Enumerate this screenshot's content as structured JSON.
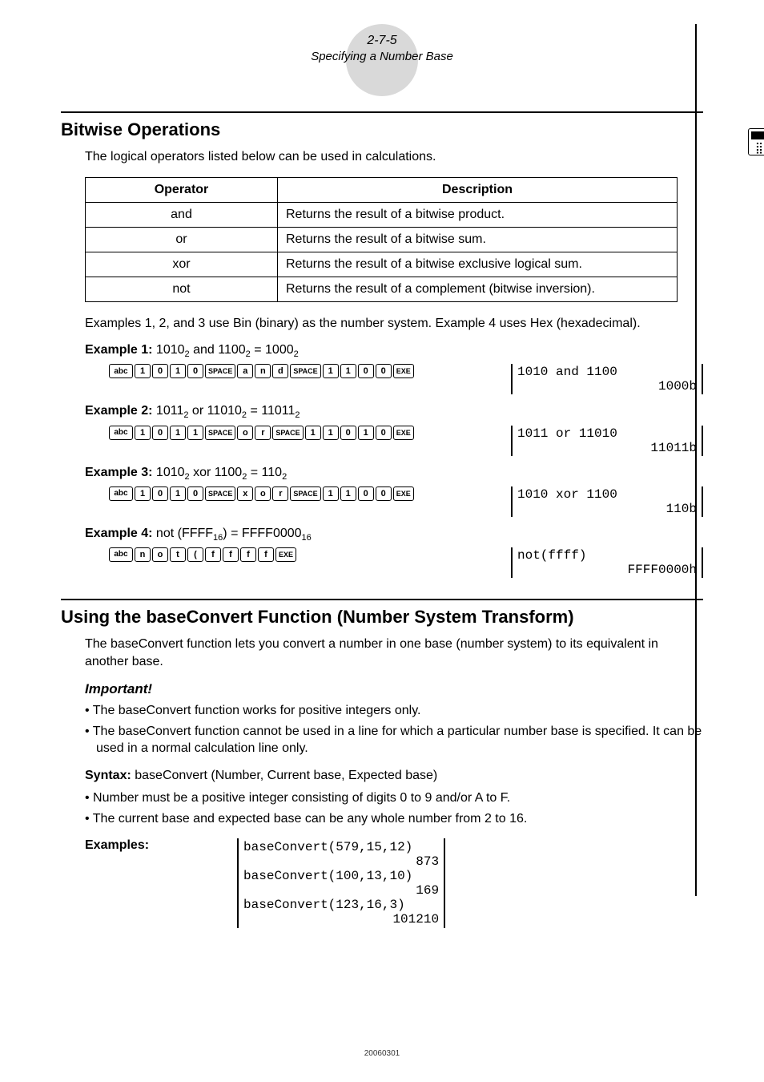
{
  "header": {
    "page_num": "2-7-5",
    "title": "Specifying a Number Base"
  },
  "section1": {
    "title": "Bitwise Operations",
    "intro": "The logical operators listed below can be used in calculations.",
    "table": {
      "headers": [
        "Operator",
        "Description"
      ],
      "rows": [
        {
          "op": "and",
          "desc": "Returns the result of a bitwise product."
        },
        {
          "op": "or",
          "desc": "Returns the result of a bitwise sum."
        },
        {
          "op": "xor",
          "desc": "Returns the result of a bitwise exclusive logical sum."
        },
        {
          "op": "not",
          "desc": "Returns the result of a complement (bitwise inversion)."
        }
      ]
    },
    "examples_intro": "Examples 1, 2, and 3 use Bin (binary) as the number system. Example 4 uses Hex (hexadecimal).",
    "examples": [
      {
        "label": "Example 1:",
        "expr_plain": "1010₂ and 1100₂ = 1000₂",
        "keys": [
          "abc",
          "1",
          "0",
          "1",
          "0",
          "SPACE",
          "a",
          "n",
          "d",
          "SPACE",
          "1",
          "1",
          "0",
          "0",
          "EXE"
        ],
        "screen_in": "1010 and 1100",
        "screen_out": "1000b"
      },
      {
        "label": "Example 2:",
        "expr_plain": "1011₂ or 11010₂ = 11011₂",
        "keys": [
          "abc",
          "1",
          "0",
          "1",
          "1",
          "SPACE",
          "o",
          "r",
          "SPACE",
          "1",
          "1",
          "0",
          "1",
          "0",
          "EXE"
        ],
        "screen_in": "1011 or 11010",
        "screen_out": "11011b"
      },
      {
        "label": "Example 3:",
        "expr_plain": "1010₂ xor 1100₂ = 110₂",
        "keys": [
          "abc",
          "1",
          "0",
          "1",
          "0",
          "SPACE",
          "x",
          "o",
          "r",
          "SPACE",
          "1",
          "1",
          "0",
          "0",
          "EXE"
        ],
        "screen_in": "1010 xor 1100",
        "screen_out": "110b"
      },
      {
        "label": "Example 4:",
        "expr_plain": "not (FFFF₁₆) = FFFF0000₁₆",
        "keys": [
          "abc",
          "n",
          "o",
          "t",
          "(",
          "f",
          "f",
          "f",
          "f",
          "EXE"
        ],
        "screen_in": "not(ffff)",
        "screen_out": "FFFF0000h"
      }
    ]
  },
  "section2": {
    "title": "Using the baseConvert Function (Number System Transform)",
    "intro": "The baseConvert function lets you convert a number in one base (number system) to its equivalent in another base.",
    "important_label": "Important!",
    "important_items": [
      "The baseConvert function works for positive integers only.",
      "The baseConvert function cannot be used in a line for which a particular number base is specified. It can be used in a normal calculation line only."
    ],
    "syntax_label": "Syntax:",
    "syntax_text": "baseConvert (Number, Current base, Expected base)",
    "syntax_items": [
      "Number must be a positive integer consisting of digits 0 to 9 and/or A to F.",
      "The current base and expected base can be any whole number from 2 to 16."
    ],
    "examples_label": "Examples:",
    "screen_lines": [
      {
        "in": "baseConvert(579,15,12)",
        "out": "873"
      },
      {
        "in": "baseConvert(100,13,10)",
        "out": "169"
      },
      {
        "in": "baseConvert(123,16,3)",
        "out": "101210"
      }
    ]
  },
  "chart_data": {
    "type": "table",
    "title": "Bitwise Operators",
    "columns": [
      "Operator",
      "Description"
    ],
    "rows": [
      [
        "and",
        "Returns the result of a bitwise product."
      ],
      [
        "or",
        "Returns the result of a bitwise sum."
      ],
      [
        "xor",
        "Returns the result of a bitwise exclusive logical sum."
      ],
      [
        "not",
        "Returns the result of a complement (bitwise inversion)."
      ]
    ]
  },
  "footer": "20060301"
}
